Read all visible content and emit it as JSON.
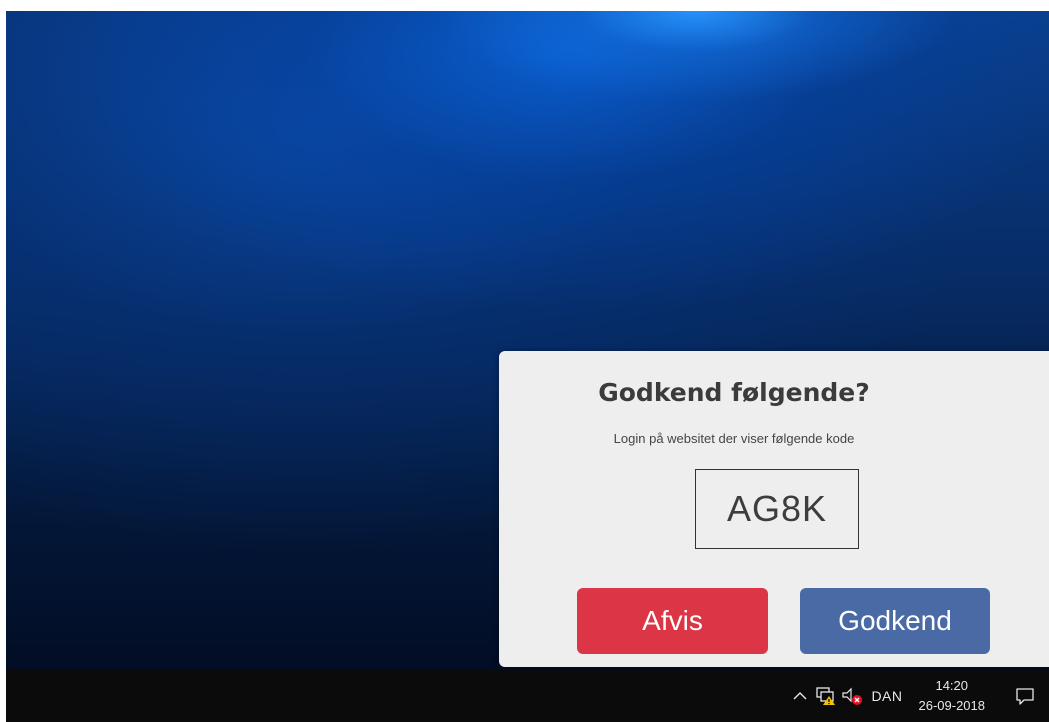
{
  "dialog": {
    "title": "Godkend følgende?",
    "subtitle": "Login på websitet der viser følgende kode",
    "code": "AG8K",
    "reject_label": "Afvis",
    "approve_label": "Godkend",
    "reject_color": "#dc3545",
    "approve_color": "#4a6aa5"
  },
  "taskbar": {
    "tray_icons": [
      "chevron-up-icon",
      "network-warning-icon",
      "speaker-muted-icon"
    ],
    "language": "DAN",
    "time": "14:20",
    "date": "26-09-2018",
    "action_center_icon": "notification-icon"
  }
}
